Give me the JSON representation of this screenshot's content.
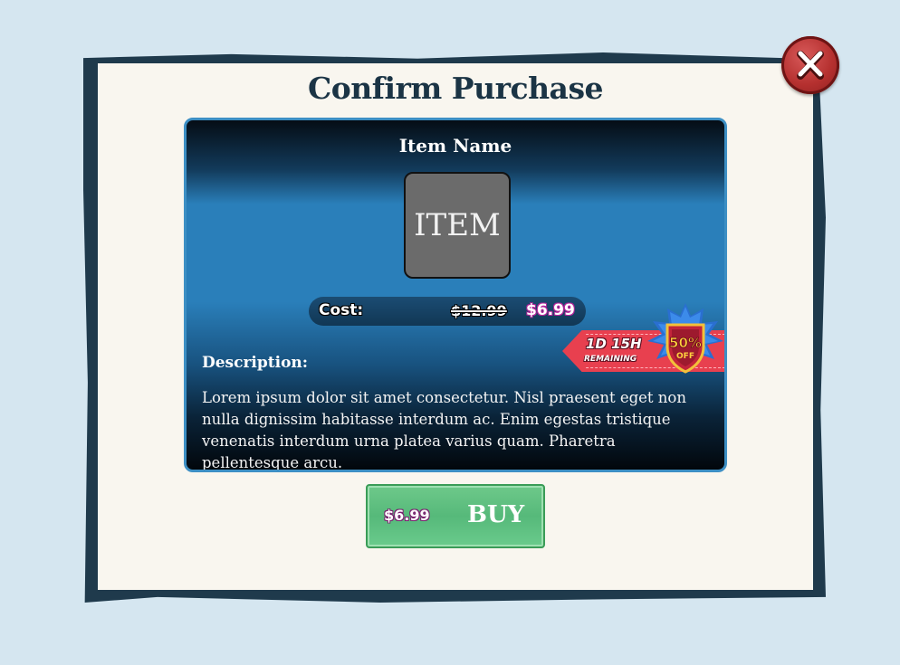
{
  "dialog": {
    "title": "Confirm Purchase",
    "close_icon": "close-x-icon"
  },
  "item": {
    "name": "Item Name",
    "placeholder": "ITEM",
    "cost_label": "Cost:",
    "original_price": "$12.99",
    "sale_price": "$6.99",
    "description_label": "Description:",
    "description": "Lorem ipsum dolor sit amet consectetur. Nisl praesent eget non nulla dignissim habitasse interdum ac. Enim egestas tristique venenatis interdum urna platea varius quam. Pharetra pellentesque arcu."
  },
  "promo": {
    "time_left": "1D 15H",
    "remaining_label": "REMAINING",
    "discount": "50%",
    "off_label": "OFF",
    "badge_icon": "discount-shield-icon"
  },
  "buy": {
    "price": "$6.99",
    "label": "BUY"
  },
  "colors": {
    "background": "#d5e6f0",
    "frame": "#1f3a4c",
    "paper": "#f9f6ef",
    "card_border": "#3d8fc4",
    "buy_button": "#5fc080",
    "close_button": "#b5302f",
    "promo_ribbon": "#e8404f"
  }
}
